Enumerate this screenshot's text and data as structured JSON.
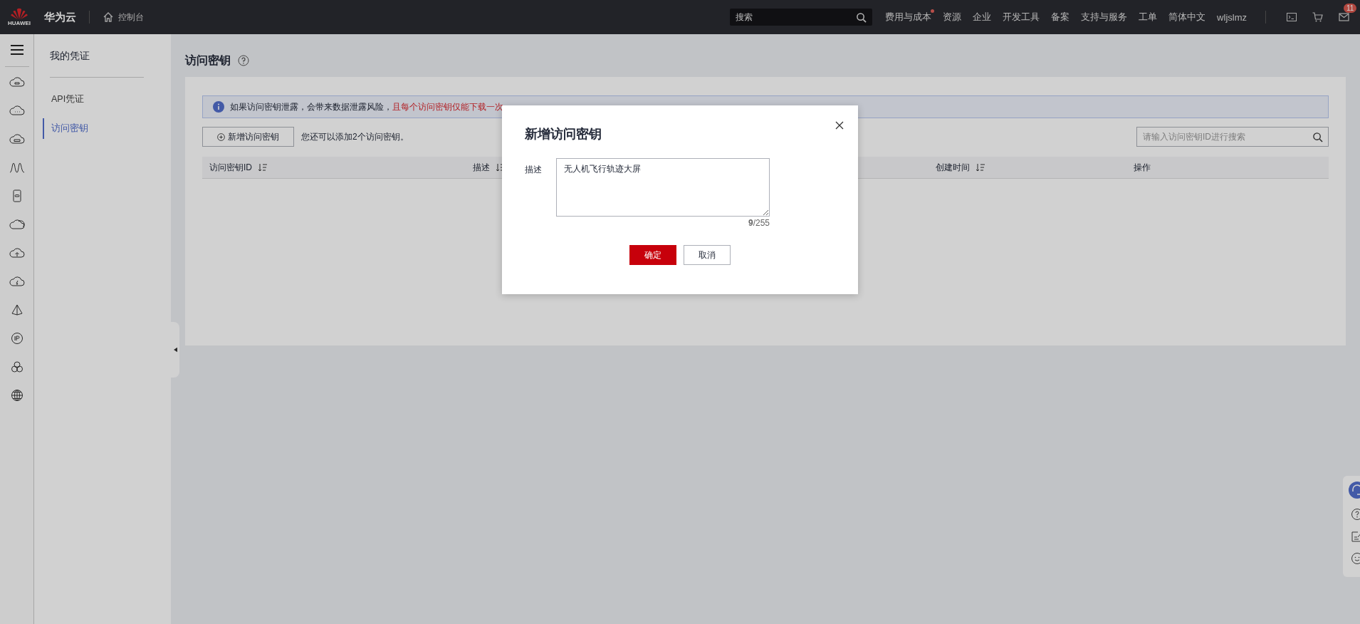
{
  "topbar": {
    "logo_text": "HUAWEI",
    "brand": "华为云",
    "console": "控制台",
    "search": {
      "placeholder": "搜索"
    },
    "nav": [
      {
        "label": "费用与成本",
        "dot": true
      },
      {
        "label": "资源",
        "dot": false
      },
      {
        "label": "企业",
        "dot": false
      },
      {
        "label": "开发工具",
        "dot": false
      },
      {
        "label": "备案",
        "dot": false
      },
      {
        "label": "支持与服务",
        "dot": false
      },
      {
        "label": "工单",
        "dot": false
      },
      {
        "label": "简体中文",
        "dot": false
      }
    ],
    "user": "wljslmz",
    "mail_badge": "11"
  },
  "sidebar": {
    "title": "我的凭证",
    "items": [
      {
        "label": "API凭证",
        "selected": false
      },
      {
        "label": "访问密钥",
        "selected": true
      }
    ]
  },
  "page": {
    "title": "访问密钥",
    "alert": {
      "text": "如果访问密钥泄露，会带来数据泄露风险，",
      "warning": "且每个访问密钥仅能下载一次"
    },
    "add_button": "新增访问密钥",
    "quota_note": "您还可以添加2个访问密钥。",
    "search": {
      "placeholder": "请输入访问密钥ID进行搜索"
    },
    "columns": [
      {
        "label": "访问密钥ID",
        "sortable": true
      },
      {
        "label": "描述",
        "sortable": true
      },
      {
        "label": "创建时间",
        "sortable": true
      },
      {
        "label": "操作",
        "sortable": false
      }
    ]
  },
  "dialog": {
    "title": "新增访问密钥",
    "field_label": "描述",
    "value": "无人机飞行轨迹大屏",
    "counter": "**9**/255",
    "buttons": [
      {
        "label": "确定",
        "kind": "primary"
      },
      {
        "label": "取消",
        "kind": "secondary"
      }
    ]
  }
}
